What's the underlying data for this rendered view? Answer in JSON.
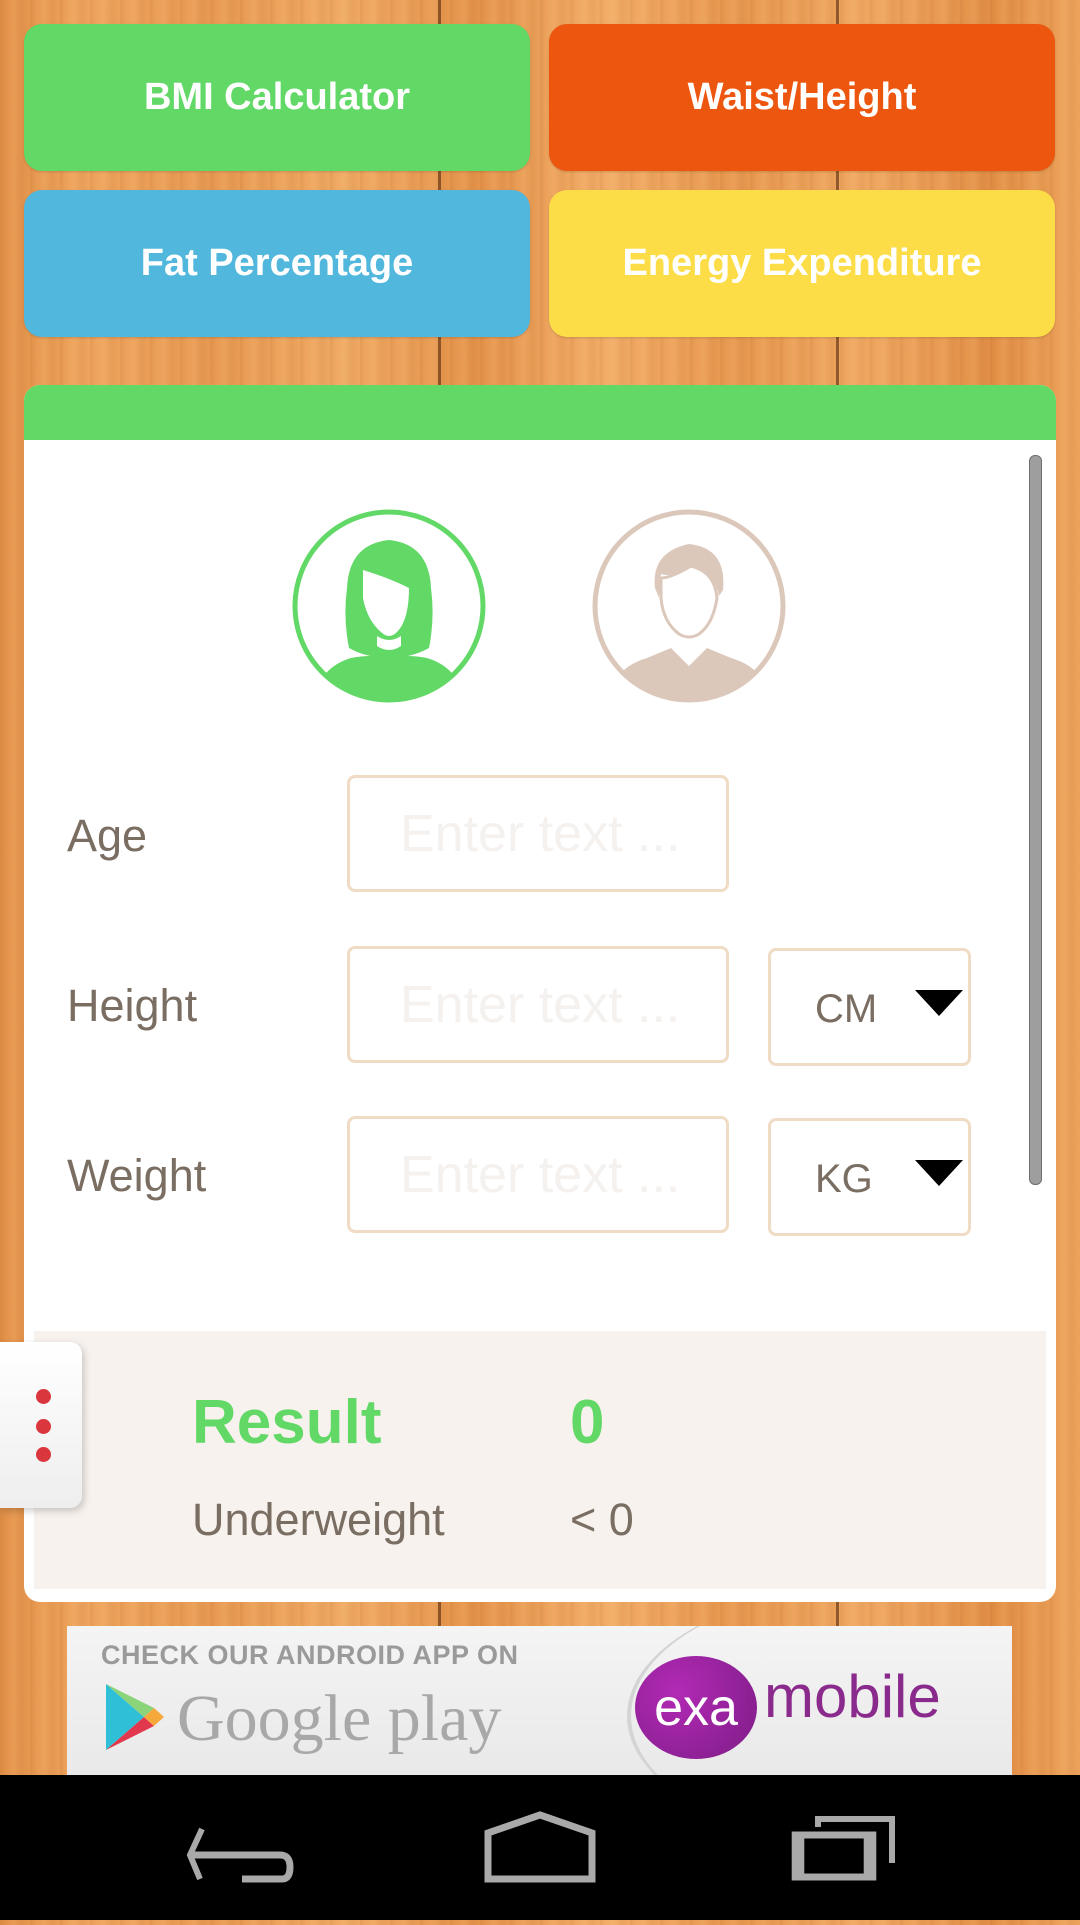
{
  "tiles": [
    {
      "label": "BMI Calculator",
      "color": "#62d866"
    },
    {
      "label": "Waist/Height",
      "color": "#ec560e"
    },
    {
      "label": "Fat Percentage",
      "color": "#52b7dc"
    },
    {
      "label": "Energy Expenditure",
      "color": "#fcdd48"
    }
  ],
  "gender": {
    "female": {
      "label": "female",
      "selected": true,
      "color": "#62d866"
    },
    "male": {
      "label": "male",
      "selected": false,
      "color": "#dcc8bb"
    }
  },
  "form": {
    "age": {
      "label": "Age",
      "value": "",
      "placeholder": "Enter text ..."
    },
    "height": {
      "label": "Height",
      "value": "",
      "placeholder": "Enter text ...",
      "unit": "CM"
    },
    "weight": {
      "label": "Weight",
      "value": "",
      "placeholder": "Enter text ...",
      "unit": "KG"
    }
  },
  "result": {
    "title": "Result",
    "value": "0",
    "category": "Underweight",
    "range": "< 0"
  },
  "ad": {
    "headline": "CHECK OUR ANDROID APP ON",
    "store": "Google play",
    "brand_badge": "exa",
    "brand_word": "mobile"
  },
  "navbar": {
    "back": "back-icon",
    "home": "home-icon",
    "recents": "recents-icon"
  }
}
